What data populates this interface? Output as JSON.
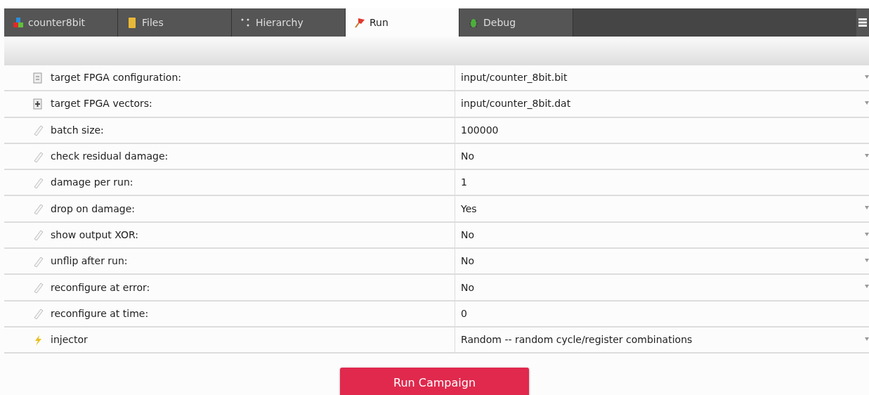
{
  "tabs": [
    {
      "label": "counter8bit",
      "selected": false
    },
    {
      "label": "Files",
      "selected": false
    },
    {
      "label": "Hierarchy",
      "selected": false
    },
    {
      "label": "Run",
      "selected": true
    },
    {
      "label": "Debug",
      "selected": false
    }
  ],
  "settings": [
    {
      "label": "target FPGA configuration:",
      "value": "input/counter_8bit.bit",
      "kind": "select"
    },
    {
      "label": "target FPGA vectors:",
      "value": "input/counter_8bit.dat",
      "kind": "select"
    },
    {
      "label": "batch size:",
      "value": "100000",
      "kind": "text"
    },
    {
      "label": "check residual damage:",
      "value": "No",
      "kind": "select"
    },
    {
      "label": "damage per run:",
      "value": "1",
      "kind": "text"
    },
    {
      "label": "drop on damage:",
      "value": "Yes",
      "kind": "select"
    },
    {
      "label": "show output XOR:",
      "value": "No",
      "kind": "select"
    },
    {
      "label": "unflip after run:",
      "value": "No",
      "kind": "select"
    },
    {
      "label": "reconfigure at error:",
      "value": "No",
      "kind": "select"
    },
    {
      "label": "reconfigure at time:",
      "value": "0",
      "kind": "text"
    },
    {
      "label": "injector",
      "value": "Random -- random cycle/register combinations",
      "kind": "select"
    }
  ],
  "run_button": "Run Campaign"
}
